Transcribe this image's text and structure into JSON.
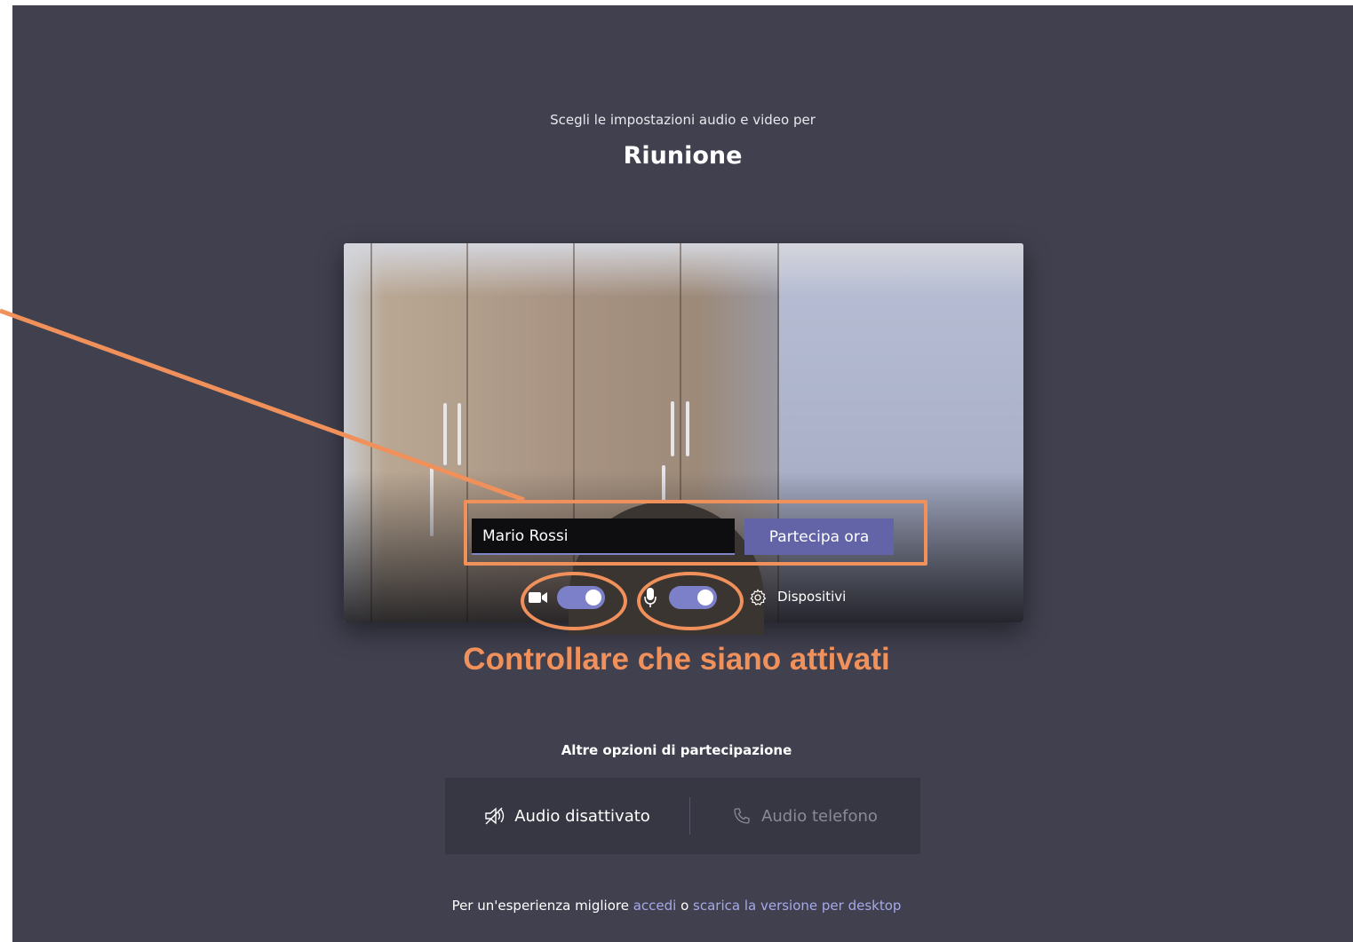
{
  "header": {
    "subtitle": "Scegli le impostazioni audio e video per",
    "meeting_title": "Riunione"
  },
  "join": {
    "name_value": "Mario Rossi",
    "join_button_label": "Partecipa ora"
  },
  "controls": {
    "camera_on": true,
    "microphone_on": true,
    "devices_label": "Dispositivi"
  },
  "annotation": {
    "text": "Controllare che siano attivati",
    "color": "#f0905a"
  },
  "options": {
    "heading": "Altre opzioni di partecipazione",
    "audio_off_label": "Audio disattivato",
    "phone_audio_label": "Audio telefono"
  },
  "footer": {
    "prefix": "Per un'esperienza migliore ",
    "signin_link": "accedi",
    "middle": " o ",
    "download_link": "scarica la versione per desktop"
  },
  "colors": {
    "background": "#40404f",
    "accent": "#6264a7",
    "toggle_on": "#7c80c8"
  }
}
